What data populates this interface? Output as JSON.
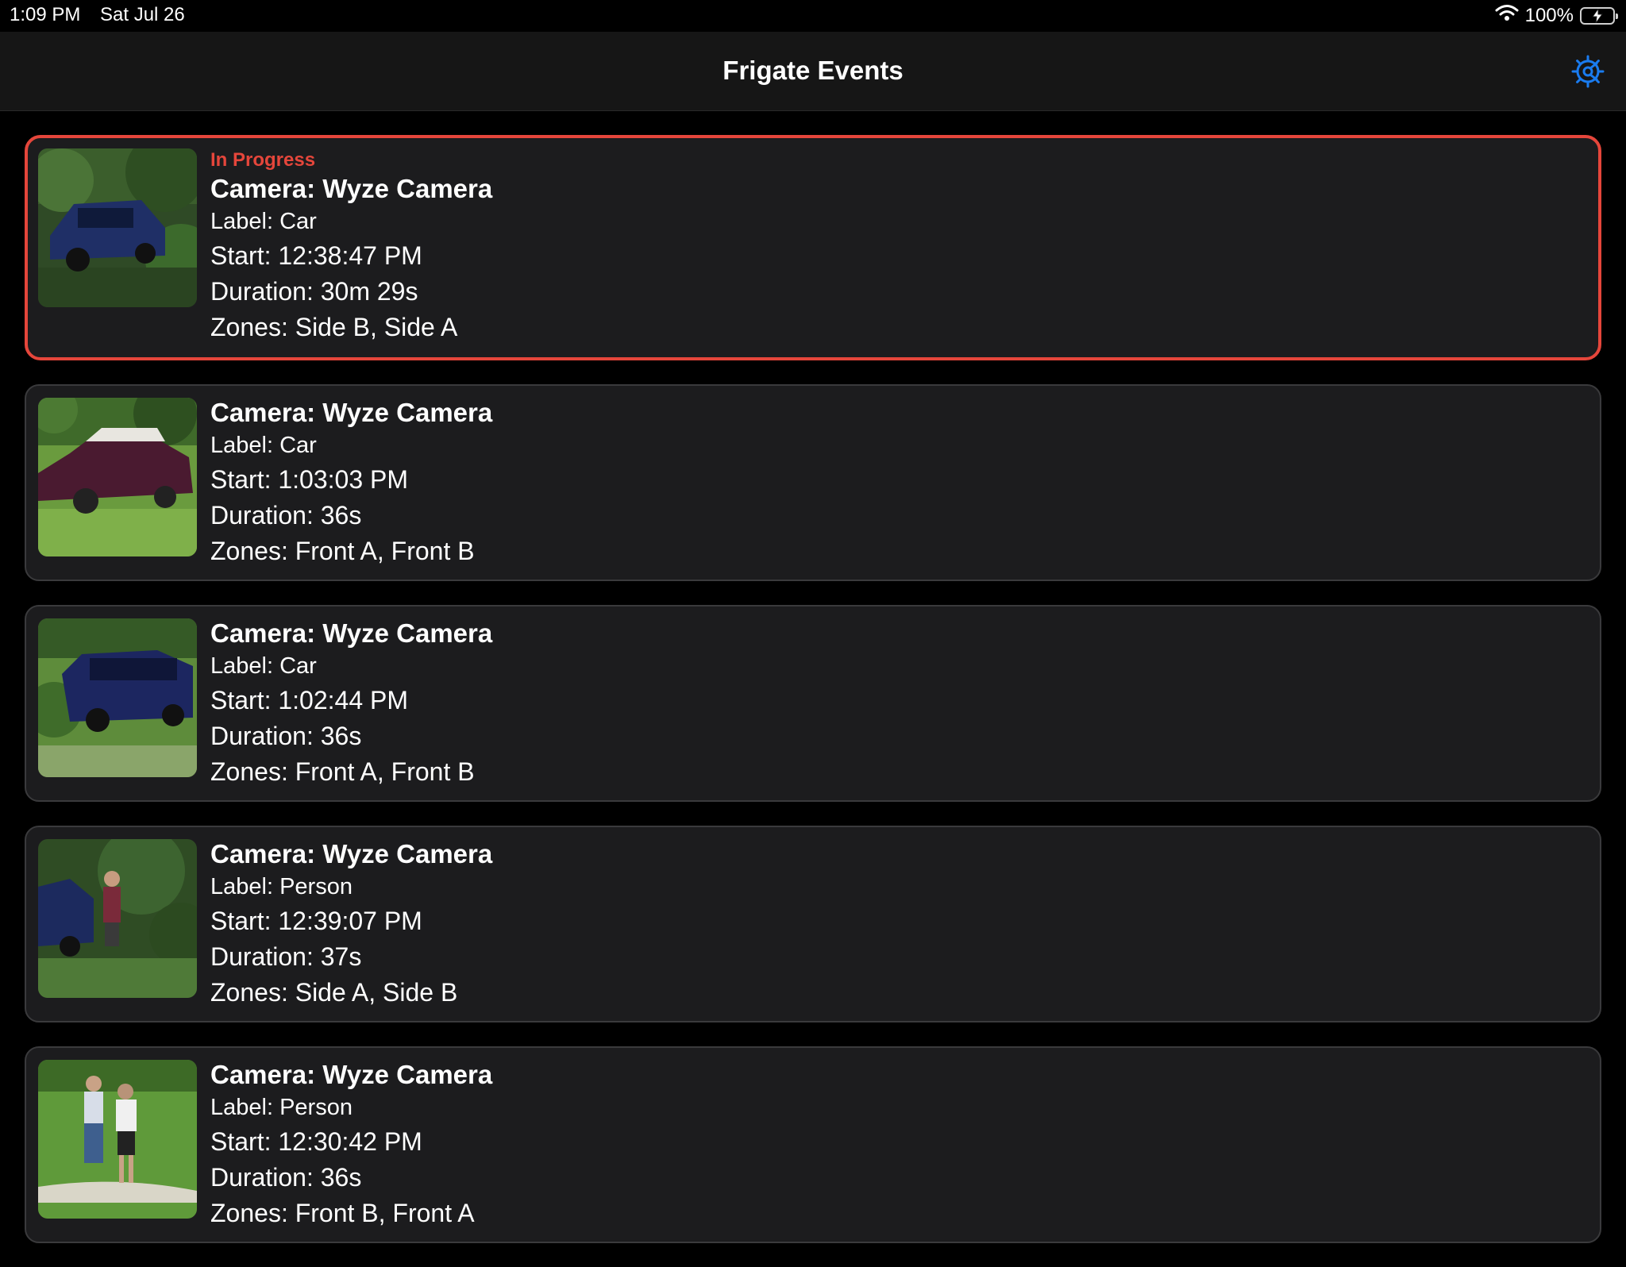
{
  "status_bar": {
    "time": "1:09 PM",
    "date": "Sat Jul 26",
    "battery": "100%"
  },
  "nav": {
    "title": "Frigate Events",
    "settings_icon": "gear-icon"
  },
  "colors": {
    "accent": "#1a7cf0",
    "in_progress": "#e5463b",
    "card_bg": "#1c1c1e",
    "battery": "#34c759"
  },
  "events": [
    {
      "status": "In Progress",
      "camera": "Camera: Wyze Camera",
      "label": "Label: Car",
      "start": "Start: 12:38:47 PM",
      "duration": "Duration: 30m 29s",
      "zones": "Zones: Side B, Side A"
    },
    {
      "camera": "Camera: Wyze Camera",
      "label": "Label: Car",
      "start": "Start: 1:03:03 PM",
      "duration": "Duration: 36s",
      "zones": "Zones: Front A, Front B"
    },
    {
      "camera": "Camera: Wyze Camera",
      "label": "Label: Car",
      "start": "Start: 1:02:44 PM",
      "duration": "Duration: 36s",
      "zones": "Zones: Front A, Front B"
    },
    {
      "camera": "Camera: Wyze Camera",
      "label": "Label: Person",
      "start": "Start: 12:39:07 PM",
      "duration": "Duration: 37s",
      "zones": "Zones: Side A, Side B"
    },
    {
      "camera": "Camera: Wyze Camera",
      "label": "Label: Person",
      "start": "Start: 12:30:42 PM",
      "duration": "Duration: 36s",
      "zones": "Zones: Front B, Front A"
    }
  ]
}
